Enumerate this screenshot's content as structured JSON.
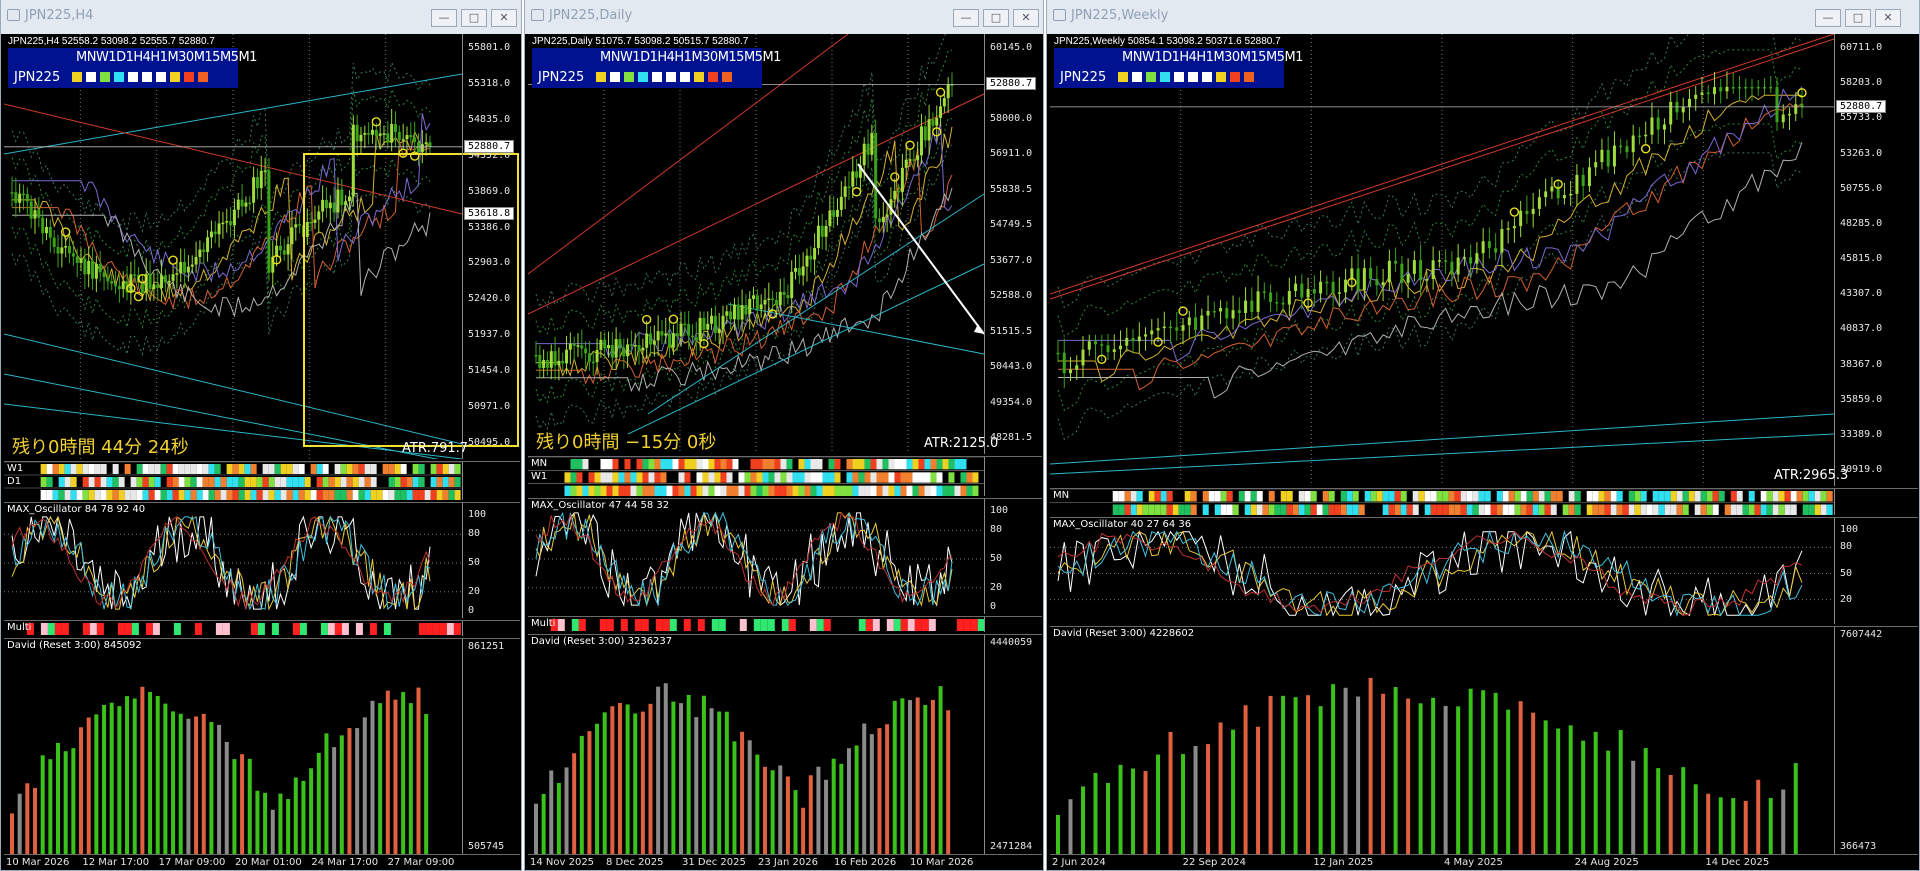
{
  "windows": [
    {
      "id": "h4",
      "title": "JPN225,H4",
      "header": "JPN225,H4  52558.2 53098.2 52555.7 52880.7",
      "tf_labels": "MNW1D1H4H1M30M15M5M1",
      "symbol": "JPN225",
      "remaining": "残り0時間 44分 24秒",
      "atr": "ATR:791.7",
      "current_price": "52880.7",
      "line_label": "53618.8",
      "price_ticks": [
        "55801.0",
        "55318.0",
        "54835.0",
        "54352.0",
        "53869.0",
        "53386.0",
        "52903.0",
        "52420.0",
        "51937.0",
        "51454.0",
        "50971.0",
        "50495.0"
      ],
      "bar_labels": [
        "W1",
        "D1",
        ""
      ],
      "osc_label": "MAX_Oscillator 84 78 92 40",
      "osc_ticks": [
        "100",
        "80",
        "50",
        "20",
        "0"
      ],
      "multi_label": "Multi",
      "david_label": "David (Reset 3:00) 845092",
      "david_ticks": [
        "861251",
        "505745"
      ],
      "time_ticks": [
        "10 Mar 2026",
        "12 Mar 17:00",
        "17 Mar 09:00",
        "20 Mar 01:00",
        "24 Mar 17:00",
        "27 Mar 09:00"
      ]
    },
    {
      "id": "d1",
      "title": "JPN225,Daily",
      "header": "JPN225,Daily  51075.7 53098.2 50515.7 52880.7",
      "tf_labels": "MNW1D1H4H1M30M15M5M1",
      "symbol": "JPN225",
      "remaining": "残り0時間 −15分 0秒",
      "atr": "ATR:2125.0",
      "current_price": "52880.7",
      "line_label": "",
      "price_ticks": [
        "60145.0",
        "59072.5",
        "58000.0",
        "56911.0",
        "55838.5",
        "54749.5",
        "53677.0",
        "52588.0",
        "51515.5",
        "50443.0",
        "49354.0",
        "48281.5"
      ],
      "bar_labels": [
        "MN",
        "W1",
        ""
      ],
      "osc_label": "MAX_Oscillator 47 44 58 32",
      "osc_ticks": [
        "100",
        "80",
        "50",
        "20",
        "0"
      ],
      "multi_label": "Multi",
      "david_label": "David (Reset 3:00) 3236237",
      "david_ticks": [
        "4440059",
        "2471284"
      ],
      "time_ticks": [
        "14 Nov 2025",
        "8 Dec 2025",
        "31 Dec 2025",
        "23 Jan 2026",
        "16 Feb 2026",
        "10 Mar 2026"
      ]
    },
    {
      "id": "w1",
      "title": "JPN225,Weekly",
      "header": "JPN225,Weekly  50854.1 53098.2 50371.6 52880.7",
      "tf_labels": "MNW1D1H4H1M30M15M5M1",
      "symbol": "JPN225",
      "remaining": "",
      "atr": "ATR:2965.3",
      "current_price": "52880.7",
      "line_label": "",
      "price_ticks": [
        "60711.0",
        "58203.0",
        "55733.0",
        "53263.0",
        "50755.0",
        "48285.0",
        "45815.0",
        "43307.0",
        "40837.0",
        "38367.0",
        "35859.0",
        "33389.0",
        "30919.0"
      ],
      "bar_labels": [
        "MN",
        ""
      ],
      "osc_label": "MAX_Oscillator 40 27 64 36",
      "osc_ticks": [
        "100",
        "80",
        "50",
        "20"
      ],
      "multi_label": "",
      "david_label": "David (Reset 3:00) 4228602",
      "david_ticks": [
        "7607442",
        "366473"
      ],
      "time_ticks": [
        "2 Jun 2024",
        "22 Sep 2024",
        "12 Jan 2025",
        "4 May 2025",
        "24 Aug 2025",
        "14 Dec 2025"
      ]
    }
  ],
  "colors": {
    "up_candle": "#9fdc3c",
    "down_candle": "#3aa31a",
    "highlight_box": "#f0e030",
    "trend_cyan": "#2bb6c8",
    "trend_red": "#d23a2a",
    "bull_volume": "#3ac21a",
    "bear_volume": "#e06040",
    "neutral_volume": "#8a8a8a"
  },
  "icons": [
    "window-icon",
    "minimize-icon",
    "maximize-icon",
    "close-icon"
  ]
}
